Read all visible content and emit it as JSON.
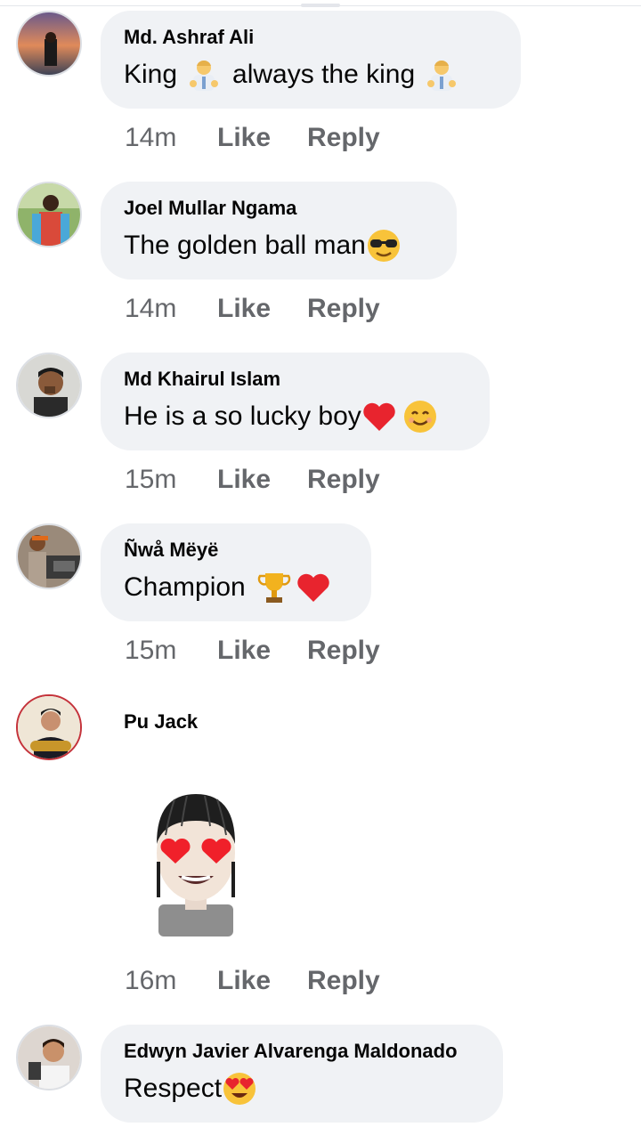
{
  "comments": [
    {
      "author": "Md. Ashraf Ali",
      "text_a": "King",
      "text_b": "always the king",
      "time": "14m",
      "like": "Like",
      "reply": "Reply"
    },
    {
      "author": "Joel Mullar Ngama",
      "text_a": "The golden ball man",
      "time": "14m",
      "like": "Like",
      "reply": "Reply"
    },
    {
      "author": "Md Khairul Islam",
      "text_a": "He is a so lucky boy",
      "time": "15m",
      "like": "Like",
      "reply": "Reply"
    },
    {
      "author": "Ñwå Mëyë",
      "text_a": "Champion",
      "time": "15m",
      "like": "Like",
      "reply": "Reply"
    },
    {
      "author": "Pu Jack",
      "time": "16m",
      "like": "Like",
      "reply": "Reply"
    },
    {
      "author": "Edwyn Javier Alvarenga Maldonado",
      "text_a": "Respect"
    }
  ],
  "icons": [
    "man-bowing-emoji",
    "sunglasses-emoji",
    "red-heart-emoji",
    "smiling-emoji",
    "trophy-emoji",
    "heart-eyes-emoji",
    "avatar-sticker"
  ]
}
